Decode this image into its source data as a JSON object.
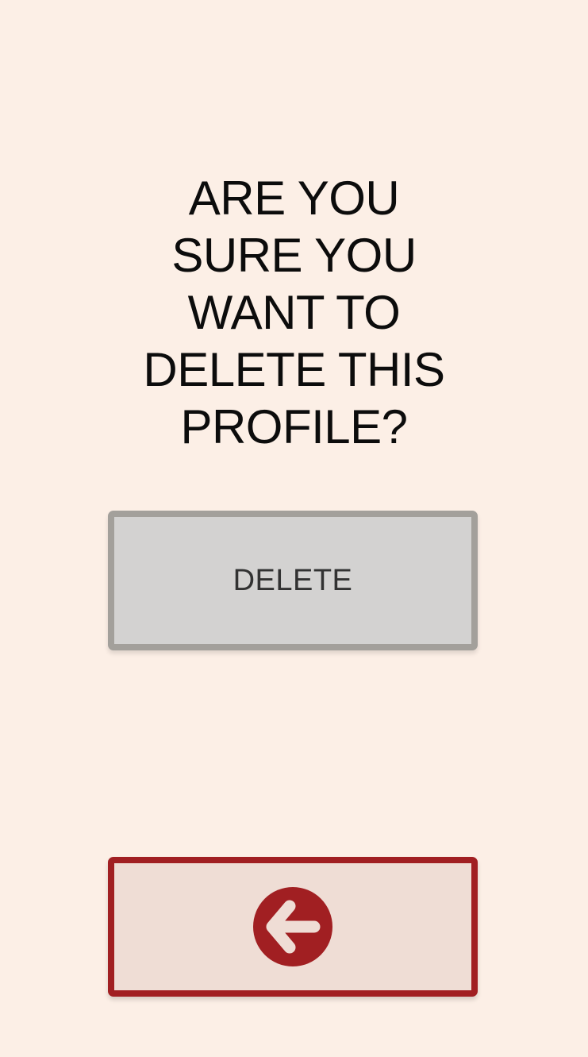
{
  "dialog": {
    "question": "ARE YOU SURE YOU WANT TO DELETE THIS PROFILE?"
  },
  "actions": {
    "delete_label": "DELETE",
    "back_icon": "arrow-left-circle-icon"
  },
  "colors": {
    "background": "#fcefe6",
    "delete_fill": "#d3d2d1",
    "delete_border": "#a3a09b",
    "back_fill": "#efddd5",
    "accent": "#a11f22"
  }
}
